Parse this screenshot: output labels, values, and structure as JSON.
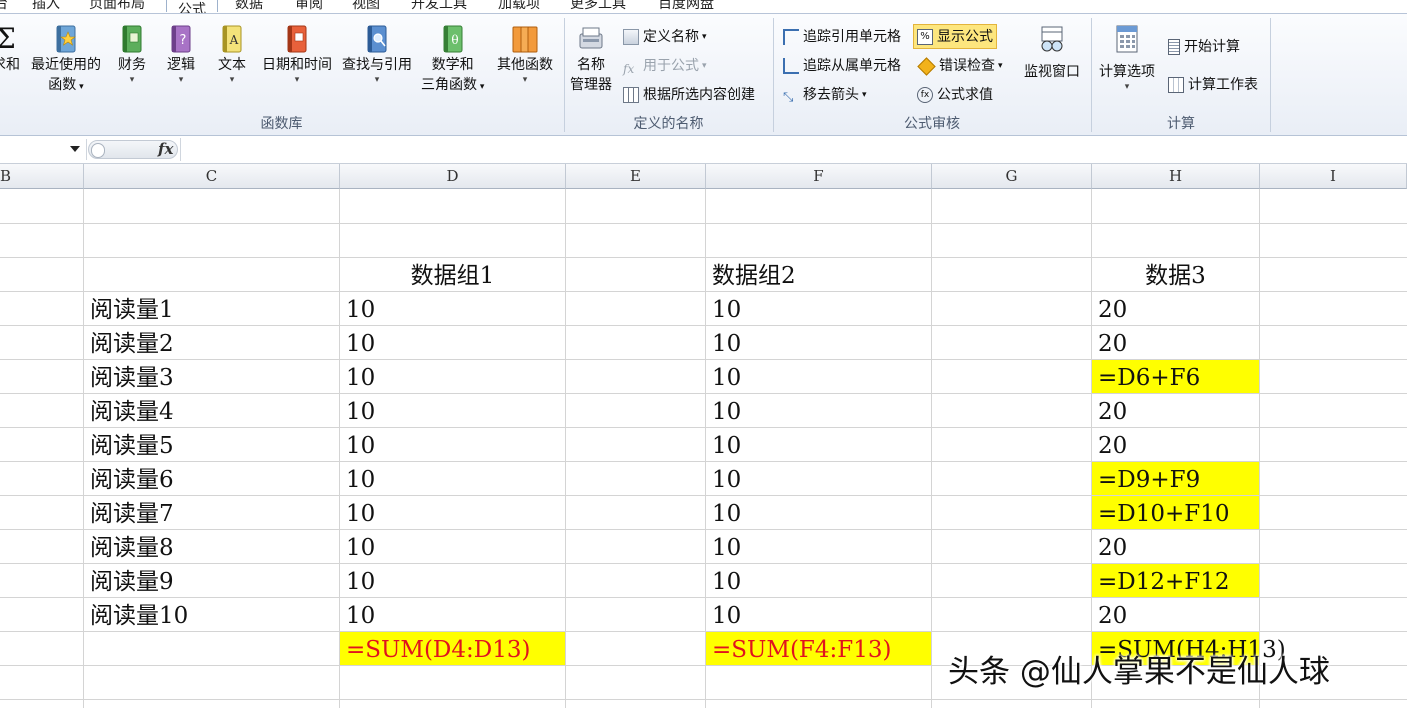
{
  "tabs": [
    "台",
    "插入",
    "页面布局",
    "公式",
    "数据",
    "审阅",
    "视图",
    "开发工具",
    "加载项",
    "更多工具",
    "百度网盘"
  ],
  "ribbon": {
    "function_library": {
      "label": "函数库",
      "autosum": "求和",
      "recent": [
        "最近使用的",
        "函数"
      ],
      "finance": "财务",
      "logic": "逻辑",
      "text": "文本",
      "datetime": "日期和时间",
      "lookup": "查找与引用",
      "math": [
        "数学和",
        "三角函数"
      ],
      "other": "其他函数"
    },
    "defined_names": {
      "label": "定义的名称",
      "name_manager": [
        "名称",
        "管理器"
      ],
      "define_name": "定义名称",
      "use_in_formula": "用于公式",
      "create_from_selection": "根据所选内容创建"
    },
    "formula_auditing": {
      "label": "公式审核",
      "trace_precedents": "追踪引用单元格",
      "trace_dependents": "追踪从属单元格",
      "remove_arrows": "移去箭头",
      "show_formulas": "显示公式",
      "error_checking": "错误检查",
      "evaluate_formula": "公式求值",
      "watch_window": "监视窗口"
    },
    "calculation": {
      "label": "计算",
      "calc_options": "计算选项",
      "calc_now": "开始计算",
      "calc_sheet": "计算工作表"
    }
  },
  "formula_bar": {
    "name_box": "",
    "fx": "fx",
    "content": ""
  },
  "columns": [
    "B",
    "C",
    "D",
    "E",
    "F",
    "G",
    "H",
    "I"
  ],
  "headers": {
    "d": "数据组1",
    "f": "数据组2",
    "h": "数据3"
  },
  "rows": [
    {
      "c": "阅读量1",
      "d": "10",
      "f": "10",
      "h": "20"
    },
    {
      "c": "阅读量2",
      "d": "10",
      "f": "10",
      "h": "20"
    },
    {
      "c": "阅读量3",
      "d": "10",
      "f": "10",
      "h": "=D6+F6"
    },
    {
      "c": "阅读量4",
      "d": "10",
      "f": "10",
      "h": "20"
    },
    {
      "c": "阅读量5",
      "d": "10",
      "f": "10",
      "h": "20"
    },
    {
      "c": "阅读量6",
      "d": "10",
      "f": "10",
      "h": "=D9+F9"
    },
    {
      "c": "阅读量7",
      "d": "10",
      "f": "10",
      "h": "=D10+F10"
    },
    {
      "c": "阅读量8",
      "d": "10",
      "f": "10",
      "h": "20"
    },
    {
      "c": "阅读量9",
      "d": "10",
      "f": "10",
      "h": "=D12+F12"
    },
    {
      "c": "阅读量10",
      "d": "10",
      "f": "10",
      "h": "20"
    }
  ],
  "totals": {
    "d": "=SUM(D4:D13)",
    "f": "=SUM(F4:F13)",
    "h": "=SUM(H4:H13)"
  },
  "highlight_color": "#ffff00",
  "watermark": "头条 @仙人掌果不是仙人球"
}
